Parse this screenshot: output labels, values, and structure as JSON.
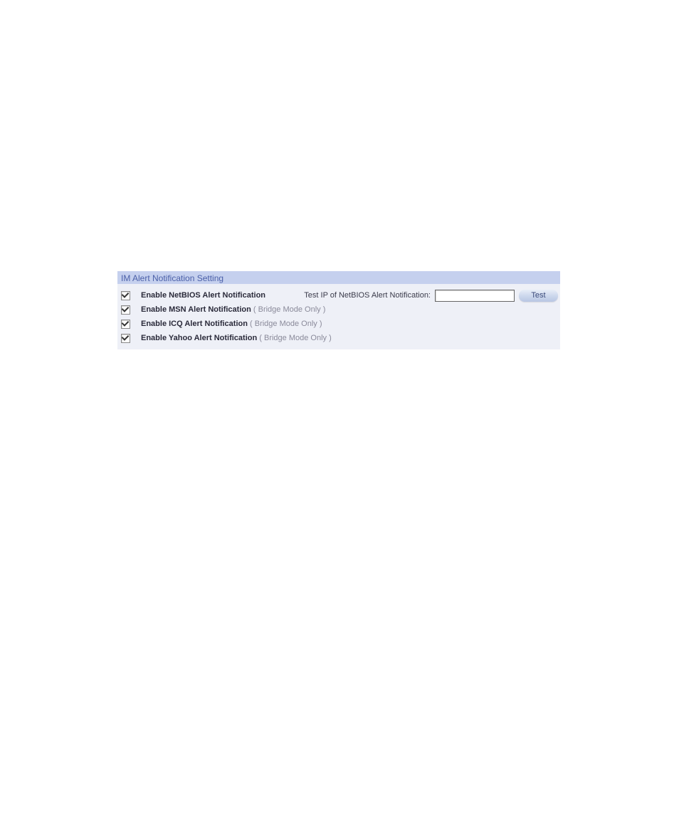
{
  "panel": {
    "title": "IM Alert Notification Setting",
    "rows": [
      {
        "label": "Enable NetBIOS Alert Notification",
        "note": "",
        "checked": true,
        "test_label": "Test IP of NetBIOS Alert Notification:",
        "test_button": "Test",
        "input_value": ""
      },
      {
        "label": "Enable MSN Alert Notification",
        "note": " ( Bridge Mode Only )",
        "checked": true
      },
      {
        "label": "Enable ICQ Alert Notification",
        "note": " ( Bridge Mode Only )",
        "checked": true
      },
      {
        "label": "Enable Yahoo Alert Notification",
        "note": " ( Bridge Mode Only )",
        "checked": true
      }
    ]
  }
}
